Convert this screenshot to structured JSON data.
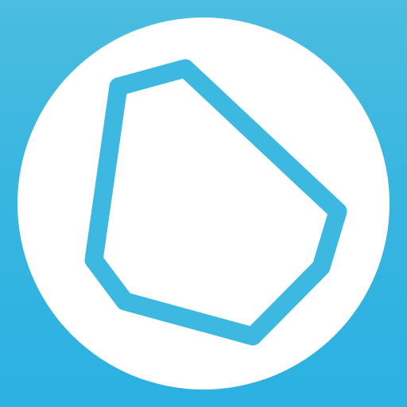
{
  "icon": {
    "name": "polygon-outline-app-icon",
    "background_color": "#3DB8E0",
    "disc_color": "#FFFFFF",
    "stroke_color": "#3DB8E0"
  }
}
